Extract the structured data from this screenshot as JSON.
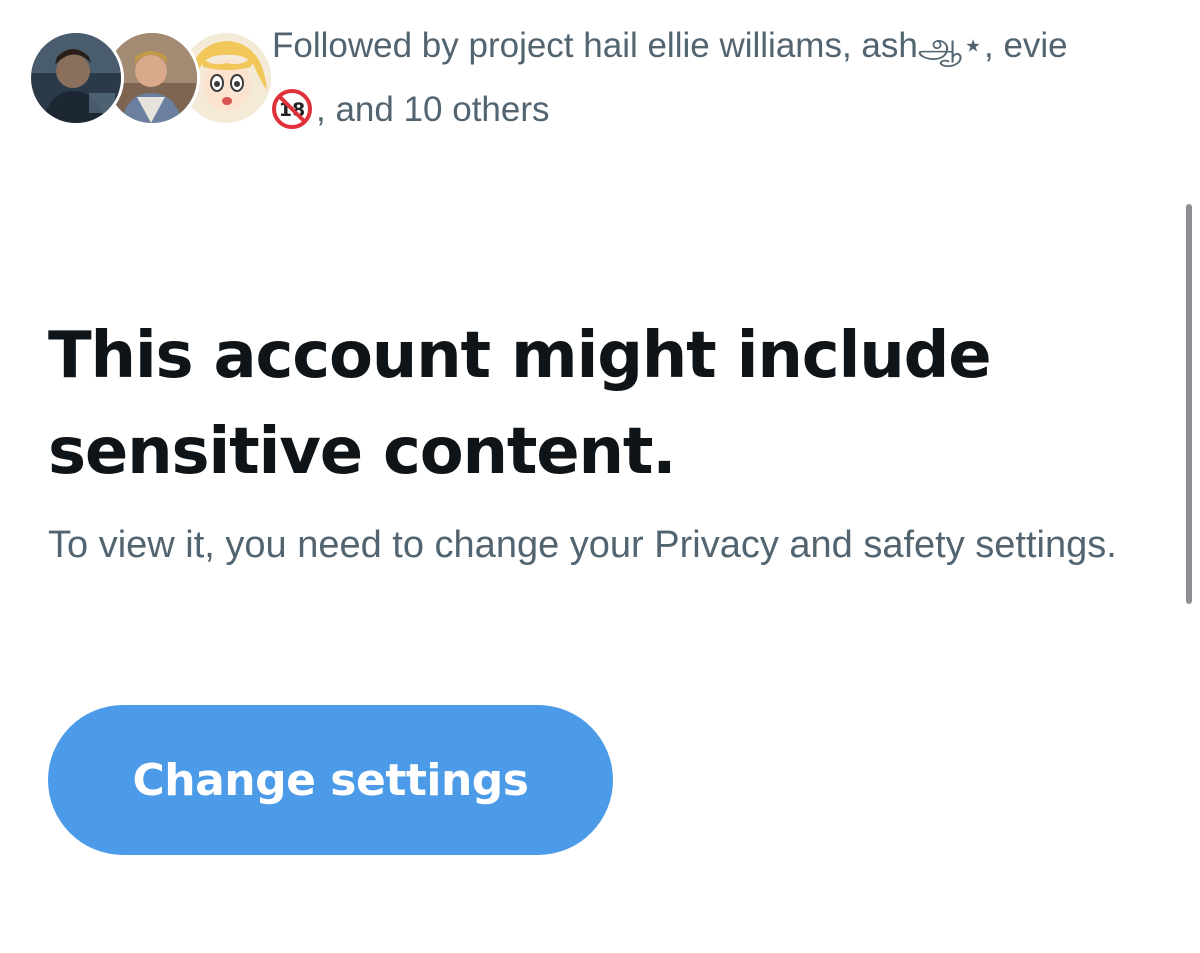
{
  "followers": {
    "avatars": [
      {
        "icon": "follower-avatar-photo-icon"
      },
      {
        "icon": "follower-avatar-photo-icon"
      },
      {
        "icon": "follower-avatar-anime-icon"
      }
    ],
    "text_line1": "Followed by project hail ellie williams, ashஆ⋆, evie",
    "badge_icon": "no-under-18-emoji-icon",
    "text_line2": ", and 10 others"
  },
  "notice": {
    "title": "This account might include sensitive content.",
    "description": "To view it, you need to change your Privacy and safety settings.",
    "button_label": "Change settings"
  },
  "colors": {
    "button": "#4c9be8",
    "secondary_text": "#536471",
    "primary_text": "#0f1419"
  }
}
